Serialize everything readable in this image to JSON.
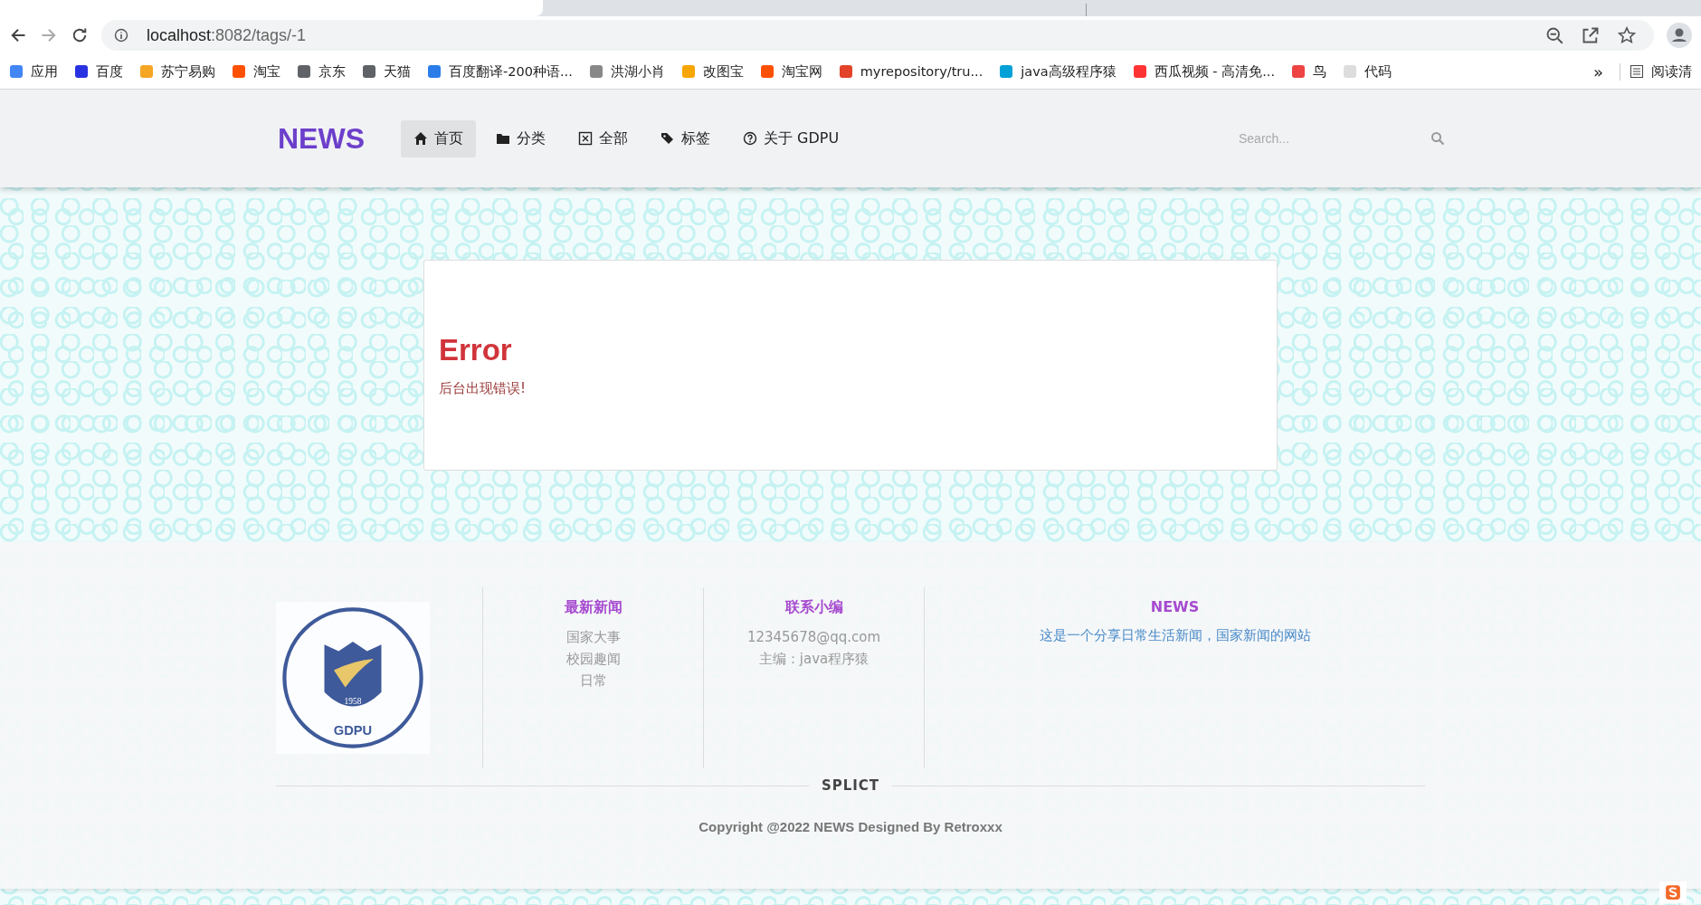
{
  "browser": {
    "url_host": "localhost",
    "url_path": ":8082/tags/-1",
    "bookmarks": [
      {
        "label": "应用"
      },
      {
        "label": "百度"
      },
      {
        "label": "苏宁易购"
      },
      {
        "label": "淘宝"
      },
      {
        "label": "京东"
      },
      {
        "label": "天猫"
      },
      {
        "label": "百度翻译-200种语..."
      },
      {
        "label": "洪湖小肖"
      },
      {
        "label": "改图宝"
      },
      {
        "label": "淘宝网"
      },
      {
        "label": "myrepository/tru..."
      },
      {
        "label": "java高级程序猿"
      },
      {
        "label": "西瓜视频 - 高清免..."
      },
      {
        "label": "鸟"
      },
      {
        "label": "代码"
      }
    ],
    "more": "»",
    "reading_list": "阅读清"
  },
  "nav": {
    "brand": "NEWS",
    "items": [
      {
        "label": "首页",
        "selected": true
      },
      {
        "label": "分类",
        "selected": false
      },
      {
        "label": "全部",
        "selected": false
      },
      {
        "label": "标签",
        "selected": false
      },
      {
        "label": "关于 GDPU",
        "selected": false
      }
    ],
    "search": {
      "placeholder": "Search..."
    }
  },
  "error": {
    "title": "Error",
    "message": "后台出现错误!"
  },
  "footer": {
    "logo": {
      "year": "1958",
      "name": "GDPU"
    },
    "columns": [
      {
        "heading": "最新新闻",
        "kind": "links",
        "lines": [
          "国家大事",
          "校园趣闻",
          "日常"
        ]
      },
      {
        "heading": "联系小编",
        "kind": "plain",
        "lines": [
          "12345678@qq.com",
          "主编：java程序猿"
        ]
      },
      {
        "heading": "NEWS",
        "kind": "about",
        "lines": [
          "这是一个分享日常生活新闻，国家新闻的网站"
        ]
      }
    ],
    "divider": "SPLICT",
    "copyright": "Copyright @2022 NEWS Designed By Retroxxx"
  }
}
